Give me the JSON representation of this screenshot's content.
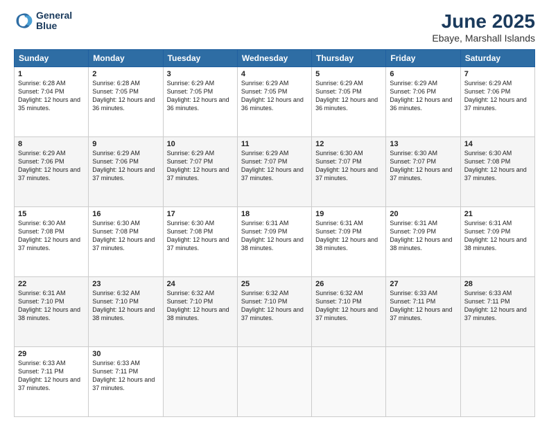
{
  "header": {
    "logo_line1": "General",
    "logo_line2": "Blue",
    "title": "June 2025",
    "subtitle": "Ebaye, Marshall Islands"
  },
  "weekdays": [
    "Sunday",
    "Monday",
    "Tuesday",
    "Wednesday",
    "Thursday",
    "Friday",
    "Saturday"
  ],
  "weeks": [
    [
      {
        "day": "1",
        "sunrise": "6:28 AM",
        "sunset": "7:04 PM",
        "daylight": "12 hours and 35 minutes."
      },
      {
        "day": "2",
        "sunrise": "6:28 AM",
        "sunset": "7:05 PM",
        "daylight": "12 hours and 36 minutes."
      },
      {
        "day": "3",
        "sunrise": "6:29 AM",
        "sunset": "7:05 PM",
        "daylight": "12 hours and 36 minutes."
      },
      {
        "day": "4",
        "sunrise": "6:29 AM",
        "sunset": "7:05 PM",
        "daylight": "12 hours and 36 minutes."
      },
      {
        "day": "5",
        "sunrise": "6:29 AM",
        "sunset": "7:05 PM",
        "daylight": "12 hours and 36 minutes."
      },
      {
        "day": "6",
        "sunrise": "6:29 AM",
        "sunset": "7:06 PM",
        "daylight": "12 hours and 36 minutes."
      },
      {
        "day": "7",
        "sunrise": "6:29 AM",
        "sunset": "7:06 PM",
        "daylight": "12 hours and 37 minutes."
      }
    ],
    [
      {
        "day": "8",
        "sunrise": "6:29 AM",
        "sunset": "7:06 PM",
        "daylight": "12 hours and 37 minutes."
      },
      {
        "day": "9",
        "sunrise": "6:29 AM",
        "sunset": "7:06 PM",
        "daylight": "12 hours and 37 minutes."
      },
      {
        "day": "10",
        "sunrise": "6:29 AM",
        "sunset": "7:07 PM",
        "daylight": "12 hours and 37 minutes."
      },
      {
        "day": "11",
        "sunrise": "6:29 AM",
        "sunset": "7:07 PM",
        "daylight": "12 hours and 37 minutes."
      },
      {
        "day": "12",
        "sunrise": "6:30 AM",
        "sunset": "7:07 PM",
        "daylight": "12 hours and 37 minutes."
      },
      {
        "day": "13",
        "sunrise": "6:30 AM",
        "sunset": "7:07 PM",
        "daylight": "12 hours and 37 minutes."
      },
      {
        "day": "14",
        "sunrise": "6:30 AM",
        "sunset": "7:08 PM",
        "daylight": "12 hours and 37 minutes."
      }
    ],
    [
      {
        "day": "15",
        "sunrise": "6:30 AM",
        "sunset": "7:08 PM",
        "daylight": "12 hours and 37 minutes."
      },
      {
        "day": "16",
        "sunrise": "6:30 AM",
        "sunset": "7:08 PM",
        "daylight": "12 hours and 37 minutes."
      },
      {
        "day": "17",
        "sunrise": "6:30 AM",
        "sunset": "7:08 PM",
        "daylight": "12 hours and 37 minutes."
      },
      {
        "day": "18",
        "sunrise": "6:31 AM",
        "sunset": "7:09 PM",
        "daylight": "12 hours and 38 minutes."
      },
      {
        "day": "19",
        "sunrise": "6:31 AM",
        "sunset": "7:09 PM",
        "daylight": "12 hours and 38 minutes."
      },
      {
        "day": "20",
        "sunrise": "6:31 AM",
        "sunset": "7:09 PM",
        "daylight": "12 hours and 38 minutes."
      },
      {
        "day": "21",
        "sunrise": "6:31 AM",
        "sunset": "7:09 PM",
        "daylight": "12 hours and 38 minutes."
      }
    ],
    [
      {
        "day": "22",
        "sunrise": "6:31 AM",
        "sunset": "7:10 PM",
        "daylight": "12 hours and 38 minutes."
      },
      {
        "day": "23",
        "sunrise": "6:32 AM",
        "sunset": "7:10 PM",
        "daylight": "12 hours and 38 minutes."
      },
      {
        "day": "24",
        "sunrise": "6:32 AM",
        "sunset": "7:10 PM",
        "daylight": "12 hours and 38 minutes."
      },
      {
        "day": "25",
        "sunrise": "6:32 AM",
        "sunset": "7:10 PM",
        "daylight": "12 hours and 37 minutes."
      },
      {
        "day": "26",
        "sunrise": "6:32 AM",
        "sunset": "7:10 PM",
        "daylight": "12 hours and 37 minutes."
      },
      {
        "day": "27",
        "sunrise": "6:33 AM",
        "sunset": "7:11 PM",
        "daylight": "12 hours and 37 minutes."
      },
      {
        "day": "28",
        "sunrise": "6:33 AM",
        "sunset": "7:11 PM",
        "daylight": "12 hours and 37 minutes."
      }
    ],
    [
      {
        "day": "29",
        "sunrise": "6:33 AM",
        "sunset": "7:11 PM",
        "daylight": "12 hours and 37 minutes."
      },
      {
        "day": "30",
        "sunrise": "6:33 AM",
        "sunset": "7:11 PM",
        "daylight": "12 hours and 37 minutes."
      },
      null,
      null,
      null,
      null,
      null
    ]
  ]
}
